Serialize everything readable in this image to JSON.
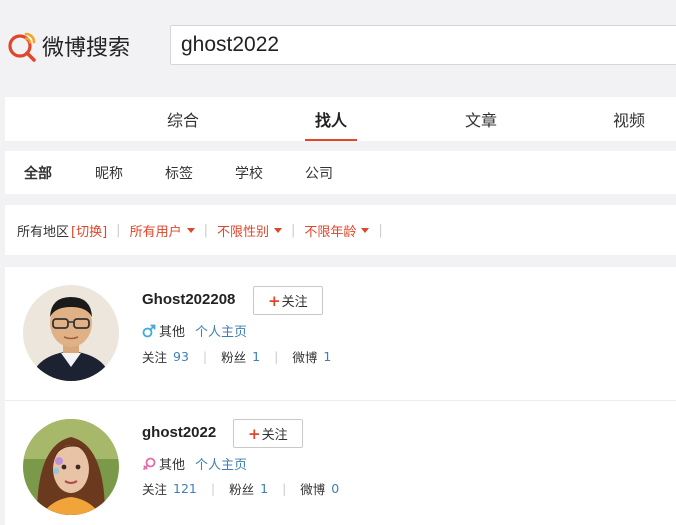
{
  "logo": {
    "text": "微博搜索"
  },
  "search": {
    "value": "ghost2022"
  },
  "main_tabs": [
    {
      "label": "综合",
      "active": false
    },
    {
      "label": "找人",
      "active": true
    },
    {
      "label": "文章",
      "active": false
    },
    {
      "label": "视频",
      "active": false
    }
  ],
  "sub_tabs": [
    {
      "label": "全部",
      "active": true
    },
    {
      "label": "昵称",
      "active": false
    },
    {
      "label": "标签",
      "active": false
    },
    {
      "label": "学校",
      "active": false
    },
    {
      "label": "公司",
      "active": false
    }
  ],
  "filters": {
    "region_label": "所有地区",
    "region_switch": "[切换]",
    "user_type": "所有用户",
    "gender": "不限性别",
    "age": "不限年龄"
  },
  "users": [
    {
      "name": "Ghost202208",
      "follow_label": "关注",
      "gender_icon": "male-icon",
      "gender_color": "#3fa9df",
      "gender_text": "其他",
      "homepage_label": "个人主页",
      "following_label": "关注",
      "following": "93",
      "followers_label": "粉丝",
      "followers": "1",
      "weibo_label": "微博",
      "weibo": "1"
    },
    {
      "name": "ghost2022",
      "follow_label": "关注",
      "gender_icon": "female-icon",
      "gender_color": "#e86aa8",
      "gender_text": "其他",
      "homepage_label": "个人主页",
      "following_label": "关注",
      "following": "121",
      "followers_label": "粉丝",
      "followers": "1",
      "weibo_label": "微博",
      "weibo": "0"
    }
  ],
  "colors": {
    "accent": "#e0462a",
    "link": "#3f7fb7"
  }
}
